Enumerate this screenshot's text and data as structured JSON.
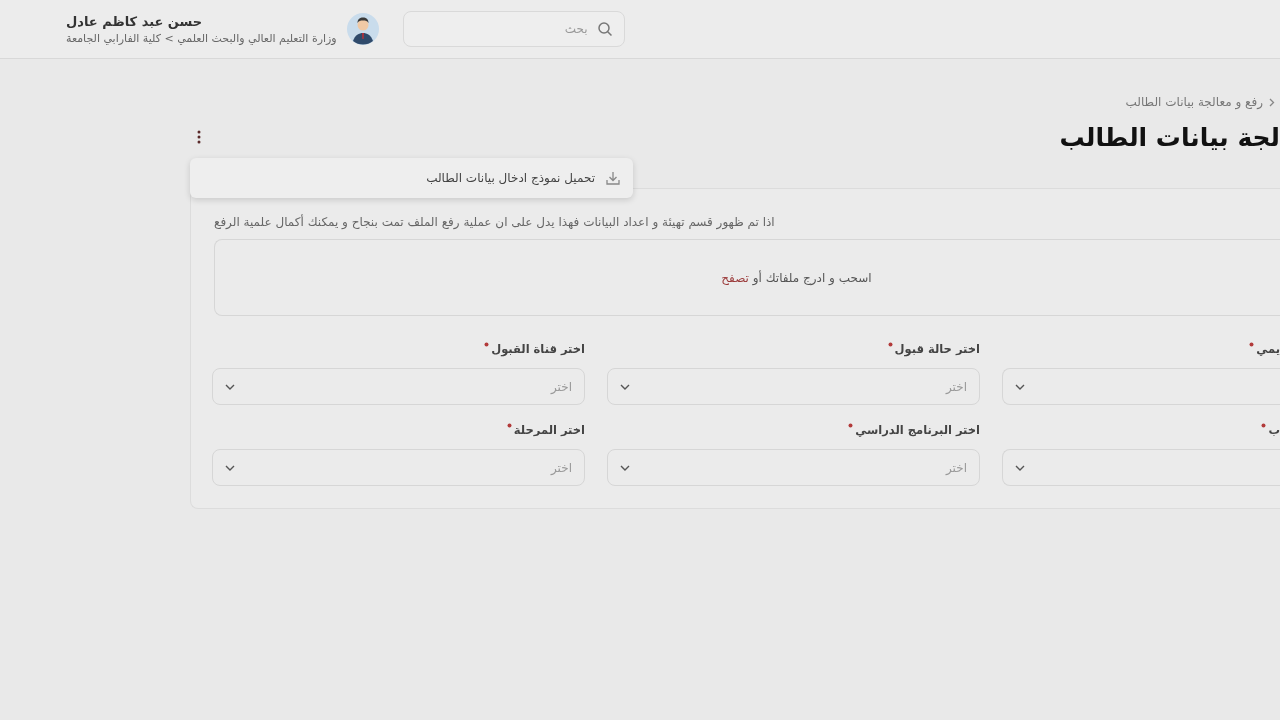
{
  "header": {
    "search": {
      "placeholder": "بحث"
    },
    "user": {
      "name": "حسن عبد كاظم عادل",
      "affiliation": "وزارة التعليم العالي والبحث العلمي > كلية الفارابي الجامعة"
    }
  },
  "breadcrumb": [
    "رفع و معالجة بيانات الطالب"
  ],
  "title": "لجة بيانات الطالب",
  "menu": {
    "open": true,
    "items": [
      {
        "label": "تحميل نموذج ادخال بيانات الطالب"
      }
    ]
  },
  "card": {
    "note": "اذا تم ظهور قسم تهيئة و اعداد البيانات فهذا يدل على ان عملية رفع الملف تمت بنجاح و يمكنك أكمال علمية الرفع",
    "dropzone": {
      "text": "اسحب و ادرج ملفاتك أو",
      "link": "تصفح"
    },
    "fields": [
      {
        "label": "يمي",
        "required": true
      },
      {
        "label": "اختر حالة قبول",
        "required": true,
        "placeholder": "اختر"
      },
      {
        "label": "اختر قناة القبول",
        "required": true,
        "placeholder": "اختر"
      },
      {
        "label": "ب",
        "required": true
      },
      {
        "label": "اختر البرنامج الدراسي",
        "required": true,
        "placeholder": "اختر"
      },
      {
        "label": "اختر المرحلة",
        "required": true,
        "placeholder": "اختر"
      }
    ]
  }
}
